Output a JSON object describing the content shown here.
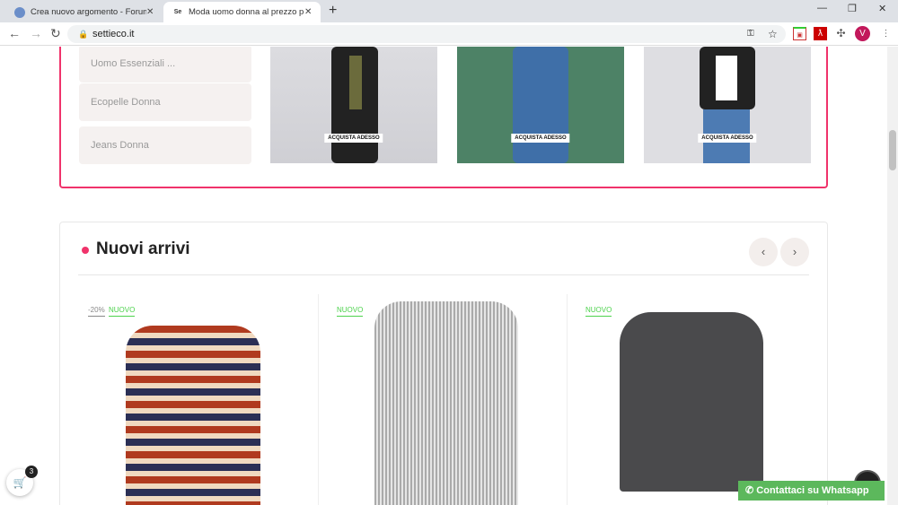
{
  "browser": {
    "tabs": [
      {
        "title": "Crea nuovo argomento - Forum I"
      },
      {
        "title": "Moda uomo donna al prezzo più"
      }
    ],
    "url": "settieco.it",
    "profile_initial": "V"
  },
  "promo": {
    "categories": [
      "Uomo Essenziali ...",
      "Ecopelle Donna",
      "Jeans Donna"
    ],
    "cta": "ACQUISTA ADESSO"
  },
  "new_arrivals": {
    "title": "Nuovi arrivi",
    "prev": "‹",
    "next": "›",
    "products": [
      {
        "discount": "-20%",
        "badge": "NUOVO"
      },
      {
        "badge": "NUOVO"
      },
      {
        "badge": "NUOVO"
      }
    ]
  },
  "cart": {
    "count": "3"
  },
  "whatsapp": {
    "label": "Contattaci su Whatsapp"
  },
  "colors": {
    "accent": "#f0336b",
    "new": "#4cd24c",
    "whatsapp": "#5cb85c"
  }
}
